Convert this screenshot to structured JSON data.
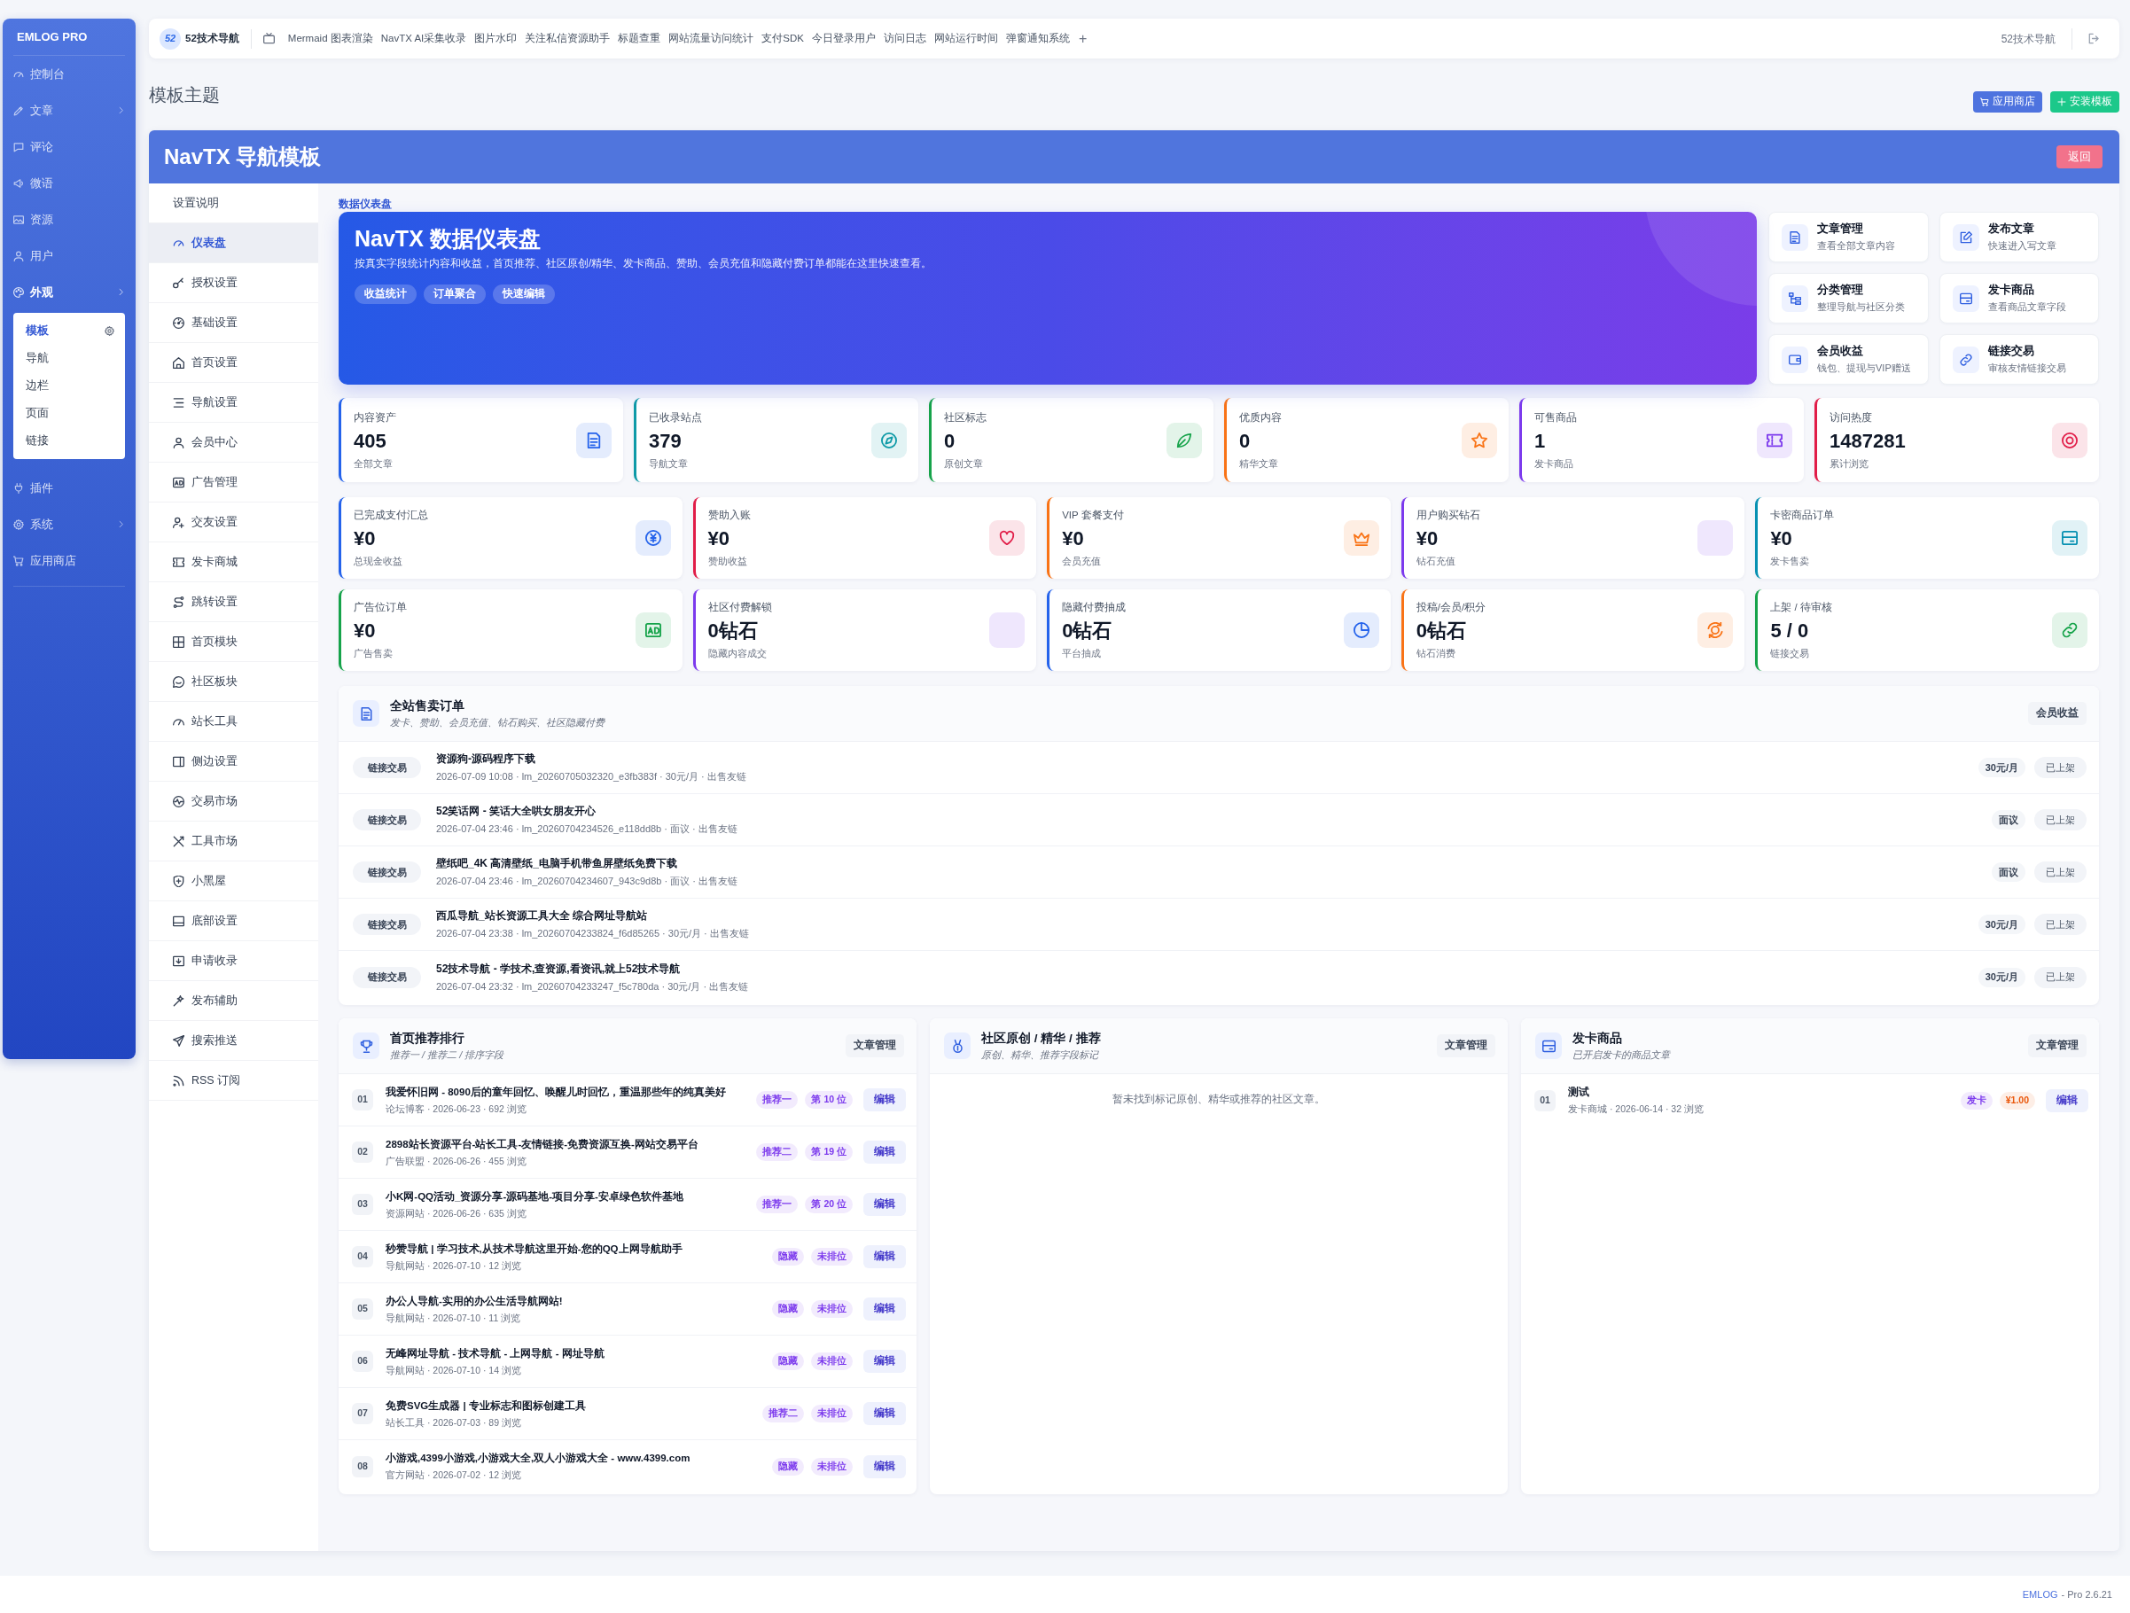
{
  "sidebar": {
    "brand": "EMLOG PRO",
    "items": [
      {
        "label": "控制台",
        "kind": "link",
        "expanded": false
      },
      {
        "label": "文章",
        "kind": "group",
        "expanded": false
      },
      {
        "label": "评论",
        "kind": "link",
        "expanded": false
      },
      {
        "label": "微语",
        "kind": "link",
        "expanded": false
      },
      {
        "label": "资源",
        "kind": "link",
        "expanded": false
      },
      {
        "label": "用户",
        "kind": "link",
        "expanded": false
      },
      {
        "label": "外观",
        "kind": "group",
        "expanded": true,
        "children": [
          {
            "label": "模板",
            "selected": true
          },
          {
            "label": "导航",
            "selected": false
          },
          {
            "label": "边栏",
            "selected": false
          },
          {
            "label": "页面",
            "selected": false
          },
          {
            "label": "链接",
            "selected": false
          }
        ]
      },
      {
        "label": "插件",
        "kind": "link",
        "expanded": false
      },
      {
        "label": "系统",
        "kind": "group",
        "expanded": false
      },
      {
        "label": "应用商店",
        "kind": "link",
        "expanded": false
      }
    ]
  },
  "topbar": {
    "logo": "52",
    "site_name": "52技术导航",
    "links": [
      "Mermaid 图表渲染",
      "NavTX AI采集收录",
      "图片水印",
      "关注私信资源助手",
      "标题查重",
      "网站流量访问统计",
      "支付SDK",
      "今日登录用户",
      "访问日志",
      "网站运行时间",
      "弹窗通知系统"
    ],
    "add": "+",
    "right_text": "52技术导航"
  },
  "page": {
    "title": "模板主题",
    "buttons": [
      {
        "label": "应用商店",
        "kind": "store"
      },
      {
        "label": "安装模板",
        "kind": "install"
      }
    ]
  },
  "panel": {
    "title": "NavTX 导航模板",
    "back": "返回",
    "menu": [
      {
        "label": "设置说明",
        "selected": false
      },
      {
        "label": "仪表盘",
        "selected": true
      },
      {
        "label": "授权设置",
        "selected": false
      },
      {
        "label": "基础设置",
        "selected": false
      },
      {
        "label": "首页设置",
        "selected": false
      },
      {
        "label": "导航设置",
        "selected": false
      },
      {
        "label": "会员中心",
        "selected": false
      },
      {
        "label": "广告管理",
        "selected": false
      },
      {
        "label": "交友设置",
        "selected": false
      },
      {
        "label": "发卡商城",
        "selected": false
      },
      {
        "label": "跳转设置",
        "selected": false
      },
      {
        "label": "首页模块",
        "selected": false
      },
      {
        "label": "社区板块",
        "selected": false
      },
      {
        "label": "站长工具",
        "selected": false
      },
      {
        "label": "侧边设置",
        "selected": false
      },
      {
        "label": "交易市场",
        "selected": false
      },
      {
        "label": "工具市场",
        "selected": false
      },
      {
        "label": "小黑屋",
        "selected": false
      },
      {
        "label": "底部设置",
        "selected": false
      },
      {
        "label": "申请收录",
        "selected": false
      },
      {
        "label": "发布辅助",
        "selected": false
      },
      {
        "label": "搜索推送",
        "selected": false
      },
      {
        "label": "RSS 订阅",
        "selected": false
      }
    ]
  },
  "dashboard": {
    "breadcrumb": "数据仪表盘",
    "hero": {
      "title": "NavTX 数据仪表盘",
      "description": "按真实字段统计内容和收益，首页推荐、社区原创/精华、发卡商品、赞助、会员充值和隐藏付费订单都能在这里快速查看。",
      "chips": [
        "收益统计",
        "订单聚合",
        "快速编辑"
      ]
    },
    "quick_links": [
      {
        "title": "文章管理",
        "subtitle": "查看全部文章内容"
      },
      {
        "title": "发布文章",
        "subtitle": "快速进入写文章"
      },
      {
        "title": "分类管理",
        "subtitle": "整理导航与社区分类"
      },
      {
        "title": "发卡商品",
        "subtitle": "查看商品文章字段"
      },
      {
        "title": "会员收益",
        "subtitle": "钱包、提现与VIP赠送"
      },
      {
        "title": "链接交易",
        "subtitle": "审核友情链接交易"
      }
    ],
    "stat_rows": [
      [
        {
          "label": "内容资产",
          "value": "405",
          "sub": "全部文章",
          "color": "#2563eb"
        },
        {
          "label": "已收录站点",
          "value": "379",
          "sub": "导航文章",
          "color": "#0e9aa7"
        },
        {
          "label": "社区标志",
          "value": "0",
          "sub": "原创文章",
          "color": "#16a34a"
        },
        {
          "label": "优质内容",
          "value": "0",
          "sub": "精华文章",
          "color": "#f97316"
        },
        {
          "label": "可售商品",
          "value": "1",
          "sub": "发卡商品",
          "color": "#7c3aed"
        },
        {
          "label": "访问热度",
          "value": "1487281",
          "sub": "累计浏览",
          "color": "#e11d48"
        }
      ],
      [
        {
          "label": "已完成支付汇总",
          "value": "¥0",
          "sub": "总现金收益",
          "color": "#2563eb"
        },
        {
          "label": "赞助入账",
          "value": "¥0",
          "sub": "赞助收益",
          "color": "#e11d48"
        },
        {
          "label": "VIP 套餐支付",
          "value": "¥0",
          "sub": "会员充值",
          "color": "#f97316"
        },
        {
          "label": "用户购买钻石",
          "value": "¥0",
          "sub": "钻石充值",
          "color": "#7c3aed"
        },
        {
          "label": "卡密商品订单",
          "value": "¥0",
          "sub": "发卡售卖",
          "color": "#0891b2"
        }
      ],
      [
        {
          "label": "广告位订单",
          "value": "¥0",
          "sub": "广告售卖",
          "color": "#16a34a"
        },
        {
          "label": "社区付费解锁",
          "value": "0钻石",
          "sub": "隐藏内容成交",
          "color": "#7c3aed"
        },
        {
          "label": "隐藏付费抽成",
          "value": "0钻石",
          "sub": "平台抽成",
          "color": "#2563eb"
        },
        {
          "label": "投稿/会员/积分",
          "value": "0钻石",
          "sub": "钻石消费",
          "color": "#f97316"
        },
        {
          "label": "上架 / 待审核",
          "value": "5 / 0",
          "sub": "链接交易",
          "color": "#16a34a"
        }
      ]
    ],
    "orders": {
      "title": "全站售卖订单",
      "subtitle": "发卡、赞助、会员充值、钻石购买、社区隐藏付费",
      "button": "会员收益",
      "rows": [
        {
          "tag": "链接交易",
          "title": "资源狗-源码程序下载",
          "meta": "2026-07-09 10:08 · lm_20260705032320_e3fb383f · 30元/月 · 出售友链",
          "price": "30元/月",
          "status": "已上架"
        },
        {
          "tag": "链接交易",
          "title": "52笑话网 - 笑话大全哄女朋友开心",
          "meta": "2026-07-04 23:46 · lm_20260704234526_e118dd8b · 面议 · 出售友链",
          "price": "面议",
          "status": "已上架"
        },
        {
          "tag": "链接交易",
          "title": "壁纸吧_4K 高清壁纸_电脑手机带鱼屏壁纸免费下载",
          "meta": "2026-07-04 23:46 · lm_20260704234607_943c9d8b · 面议 · 出售友链",
          "price": "面议",
          "status": "已上架"
        },
        {
          "tag": "链接交易",
          "title": "西瓜导航_站长资源工具大全 综合网址导航站",
          "meta": "2026-07-04 23:38 · lm_20260704233824_f6d85265 · 30元/月 · 出售友链",
          "price": "30元/月",
          "status": "已上架"
        },
        {
          "tag": "链接交易",
          "title": "52技术导航 - 学技术,查资源,看资讯,就上52技术导航",
          "meta": "2026-07-04 23:32 · lm_20260704233247_f5c780da · 30元/月 · 出售友链",
          "price": "30元/月",
          "status": "已上架"
        }
      ]
    },
    "panels": [
      {
        "title": "首页推荐排行",
        "subtitle": "推荐一 / 推荐二 / 排序字段",
        "button": "文章管理",
        "rows": [
          {
            "rank": "01",
            "title": "我爱怀旧网 - 8090后的童年回忆、唤醒儿时回忆，重温那些年的纯真美好",
            "meta": "论坛博客 · 2026-06-23 · 692 浏览",
            "tags": [
              {
                "label": "推荐一",
                "color": "#7c3aed"
              },
              {
                "label": "第 10 位",
                "color": "#7c3aed"
              }
            ],
            "action": "编辑"
          },
          {
            "rank": "02",
            "title": "2898站长资源平台-站长工具-友情链接-免费资源互换-网站交易平台",
            "meta": "广告联盟 · 2026-06-26 · 455 浏览",
            "tags": [
              {
                "label": "推荐二",
                "color": "#7c3aed"
              },
              {
                "label": "第 19 位",
                "color": "#7c3aed"
              }
            ],
            "action": "编辑"
          },
          {
            "rank": "03",
            "title": "小K网-QQ活动_资源分享-源码基地-项目分享-安卓绿色软件基地",
            "meta": "资源网站 · 2026-06-26 · 635 浏览",
            "tags": [
              {
                "label": "推荐一",
                "color": "#7c3aed"
              },
              {
                "label": "第 20 位",
                "color": "#7c3aed"
              }
            ],
            "action": "编辑"
          },
          {
            "rank": "04",
            "title": "秒赞导航 | 学习技术,从技术导航这里开始-您的QQ上网导航助手",
            "meta": "导航网站 · 2026-07-10 · 12 浏览",
            "tags": [
              {
                "label": "隐藏",
                "color": "#7c3aed"
              },
              {
                "label": "未排位",
                "color": "#7c3aed"
              }
            ],
            "action": "编辑"
          },
          {
            "rank": "05",
            "title": "办公人导航-实用的办公生活导航网站!",
            "meta": "导航网站 · 2026-07-10 · 11 浏览",
            "tags": [
              {
                "label": "隐藏",
                "color": "#7c3aed"
              },
              {
                "label": "未排位",
                "color": "#7c3aed"
              }
            ],
            "action": "编辑"
          },
          {
            "rank": "06",
            "title": "无峰网址导航 - 技术导航 - 上网导航 - 网址导航",
            "meta": "导航网站 · 2026-07-10 · 14 浏览",
            "tags": [
              {
                "label": "隐藏",
                "color": "#7c3aed"
              },
              {
                "label": "未排位",
                "color": "#7c3aed"
              }
            ],
            "action": "编辑"
          },
          {
            "rank": "07",
            "title": "免费SVG生成器 | 专业标志和图标创建工具",
            "meta": "站长工具 · 2026-07-03 · 89 浏览",
            "tags": [
              {
                "label": "推荐二",
                "color": "#7c3aed"
              },
              {
                "label": "未排位",
                "color": "#7c3aed"
              }
            ],
            "action": "编辑"
          },
          {
            "rank": "08",
            "title": "小游戏,4399小游戏,小游戏大全,双人小游戏大全 - www.4399.com",
            "meta": "官方网站 · 2026-07-02 · 12 浏览",
            "tags": [
              {
                "label": "隐藏",
                "color": "#7c3aed"
              },
              {
                "label": "未排位",
                "color": "#7c3aed"
              }
            ],
            "action": "编辑"
          }
        ]
      },
      {
        "title": "社区原创 / 精华 / 推荐",
        "subtitle": "原创、精华、推荐字段标记",
        "button": "文章管理",
        "empty_text": "暂未找到标记原创、精华或推荐的社区文章。"
      },
      {
        "title": "发卡商品",
        "subtitle": "已开启发卡的商品文章",
        "button": "文章管理",
        "rows": [
          {
            "rank": "01",
            "title": "测试",
            "meta": "发卡商城 · 2026-06-14 · 32 浏览",
            "tags": [
              {
                "label": "发卡",
                "color": "#7c3aed"
              },
              {
                "label": "¥1.00",
                "color": "#ea580c"
              }
            ],
            "action": "编辑"
          }
        ]
      }
    ]
  },
  "footer": {
    "link": "EMLOG",
    "version": "- Pro 2.6.21"
  }
}
